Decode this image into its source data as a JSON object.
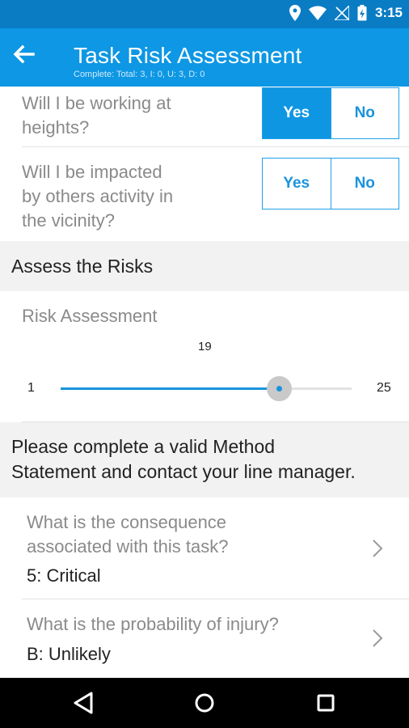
{
  "status_bar": {
    "time": "3:15"
  },
  "app_bar": {
    "title": "Task Risk Assessment",
    "subtitle": "Complete: Total: 3, I: 0, U: 3, D: 0"
  },
  "questions": [
    {
      "text": "Will I be working at heights?",
      "lines": [
        "Will I be working at",
        "heights?"
      ],
      "yes": "Yes",
      "no": "No",
      "selected": "Yes"
    },
    {
      "text": "Will I be impacted by others activity in the vicinity?",
      "lines": [
        "Will I be impacted",
        "by others activity in",
        "the vicinity?"
      ],
      "yes": "Yes",
      "no": "No",
      "selected": null
    }
  ],
  "section": {
    "title": "Assess the Risks"
  },
  "risk_slider": {
    "label": "Risk Assessment",
    "value": 19,
    "min": 1,
    "max": 25
  },
  "warning": {
    "lines": [
      "Please complete a valid Method",
      "Statement and contact your line manager."
    ]
  },
  "nav_items": [
    {
      "question_lines": [
        "What is the consequence",
        "associated with this task?"
      ],
      "answer": "5: Critical"
    },
    {
      "question_lines": [
        "What is the probability of injury?"
      ],
      "answer": "B: Unlikely"
    }
  ],
  "icons": {
    "back": "arrow-left-icon",
    "location": "location-icon",
    "wifi": "wifi-icon",
    "signal": "no-signal-icon",
    "battery": "battery-icon",
    "chevron": "chevron-right-icon",
    "nav_back": "nav-back-icon",
    "nav_home": "nav-home-icon",
    "nav_recents": "nav-recents-icon"
  },
  "colors": {
    "status_bar": "#0a7cc4",
    "app_bar": "#0d97e4",
    "accent": "#1a93dd"
  }
}
